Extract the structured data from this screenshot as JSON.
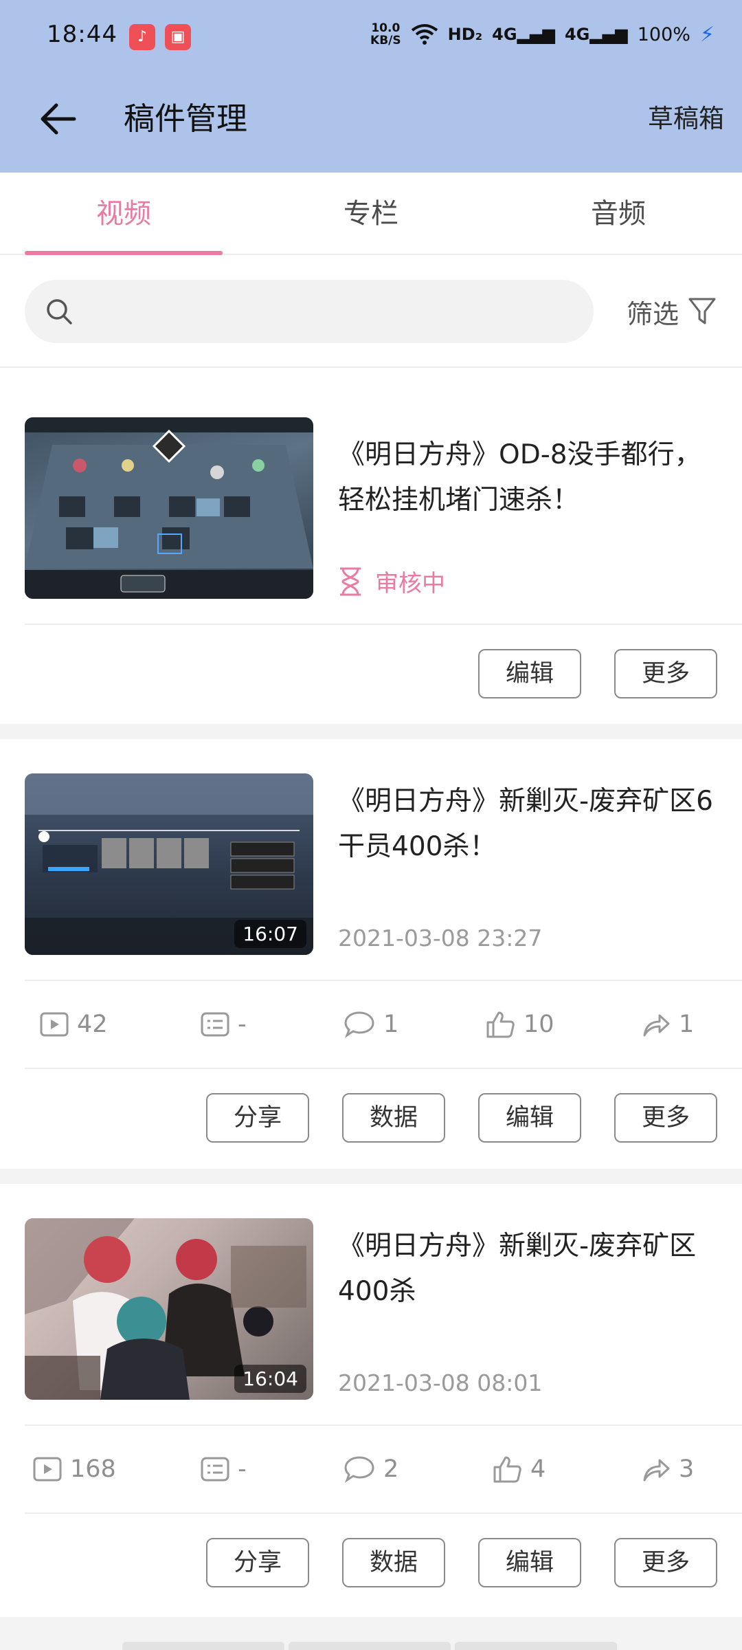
{
  "status_bar": {
    "time": "18:44",
    "net_speed_value": "10.0",
    "net_speed_unit": "KB/S",
    "hd_label": "HD₂",
    "sim1_label": "4G",
    "sim2_label": "4G",
    "battery": "100%",
    "app_icons": [
      "music-app-icon",
      "video-record-icon"
    ]
  },
  "header": {
    "title": "稿件管理",
    "drafts": "草稿箱"
  },
  "tabs": [
    {
      "label": "视频",
      "active": true
    },
    {
      "label": "专栏",
      "active": false
    },
    {
      "label": "音频",
      "active": false
    }
  ],
  "search": {
    "placeholder": "",
    "filter_label": "筛选"
  },
  "colors": {
    "accent": "#ea7aa1",
    "header_bg": "#aec3ea",
    "muted": "#9a9a9a"
  },
  "videos": [
    {
      "title": "《明日方舟》OD-8没手都行，轻松挂机堵门速杀！",
      "status": "审核中",
      "actions": [
        "编辑",
        "更多"
      ]
    },
    {
      "title": "《明日方舟》新剿灭-废弃矿区6干员400杀！",
      "duration": "16:07",
      "date": "2021-03-08 23:27",
      "stats": {
        "plays": "42",
        "danmaku": "-",
        "comments": "1",
        "likes": "10",
        "shares": "1"
      },
      "actions": [
        "分享",
        "数据",
        "编辑",
        "更多"
      ]
    },
    {
      "title": "《明日方舟》新剿灭-废弃矿区400杀",
      "duration": "16:04",
      "date": "2021-03-08 08:01",
      "stats": {
        "plays": "168",
        "danmaku": "-",
        "comments": "2",
        "likes": "4",
        "shares": "3"
      },
      "actions": [
        "分享",
        "数据",
        "编辑",
        "更多"
      ]
    }
  ]
}
